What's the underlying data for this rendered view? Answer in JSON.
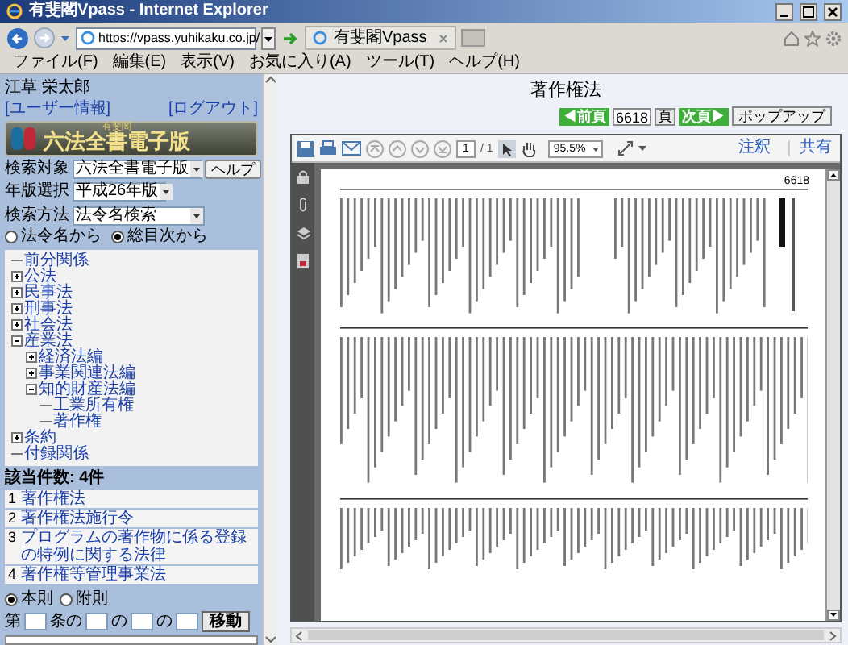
{
  "window": {
    "title": "有斐閣Vpass - Internet Explorer"
  },
  "address_bar": {
    "url": "https://vpass.yuhikaku.co.jp/"
  },
  "tab": {
    "label": "有斐閣Vpass"
  },
  "menu": [
    "ファイル(F)",
    "編集(E)",
    "表示(V)",
    "お気に入り(A)",
    "ツール(T)",
    "ヘルプ(H)"
  ],
  "sidebar": {
    "user": "江草 栄太郎",
    "links": [
      "[ユーザー情報]",
      "[ログアウト]"
    ],
    "logo": {
      "publisher": "有斐閣",
      "product": "六法全書電子版"
    },
    "filters": [
      {
        "label": "検索対象",
        "value": "六法全書電子版",
        "button": "ヘルプ"
      },
      {
        "label": "年版選択",
        "value": "平成26年版"
      },
      {
        "label": "検索方法",
        "value": "法令名検索"
      }
    ],
    "modes": [
      {
        "label": "法令名から",
        "selected": false
      },
      {
        "label": "総目次から",
        "selected": true
      }
    ],
    "tree": [
      {
        "label": "前分関係",
        "kind": "leaf"
      },
      {
        "label": "公法",
        "kind": "folder",
        "expanded": false
      },
      {
        "label": "民事法",
        "kind": "folder",
        "expanded": false
      },
      {
        "label": "刑事法",
        "kind": "folder",
        "expanded": false
      },
      {
        "label": "社会法",
        "kind": "folder",
        "expanded": false
      },
      {
        "label": "産業法",
        "kind": "folder",
        "expanded": true,
        "children": [
          {
            "label": "経済法編",
            "kind": "folder",
            "expanded": false
          },
          {
            "label": "事業関連法編",
            "kind": "folder",
            "expanded": false
          },
          {
            "label": "知的財産法編",
            "kind": "folder",
            "expanded": true,
            "children": [
              {
                "label": "工業所有権",
                "kind": "leaf"
              },
              {
                "label": "著作権",
                "kind": "leaf"
              }
            ]
          }
        ]
      },
      {
        "label": "条約",
        "kind": "folder",
        "expanded": false
      },
      {
        "label": "付録関係",
        "kind": "leaf"
      }
    ],
    "result_count": "該当件数: 4件",
    "results": [
      {
        "number": "1",
        "title": "著作権法"
      },
      {
        "number": "2",
        "title": "著作権法施行令"
      },
      {
        "number": "3",
        "title": "プログラムの著作物に係る登録の特例に関する法律"
      },
      {
        "number": "4",
        "title": "著作権等管理事業法"
      }
    ],
    "scopes": [
      {
        "label": "本則",
        "selected": true
      },
      {
        "label": "附則",
        "selected": false
      }
    ],
    "jump": {
      "labels": [
        "第",
        "条の",
        "の",
        "の"
      ],
      "button": "移動"
    }
  },
  "content": {
    "title": "著作権法",
    "pager": {
      "prev": "◀前頁",
      "page": "6618",
      "page_button": "頁",
      "next": "次頁▶",
      "popup": "ポップアップ"
    },
    "pdf_toolbar": {
      "page": "1",
      "total": "/ 1",
      "zoom": "95.5%",
      "comment": "注釈",
      "share": "共有"
    },
    "pdf_page": {
      "page_number": "6618"
    }
  }
}
